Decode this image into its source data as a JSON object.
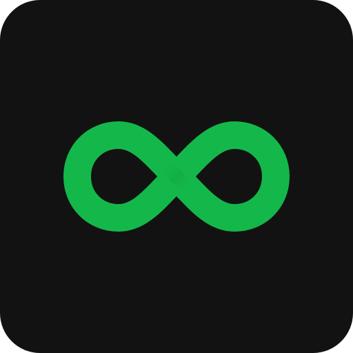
{
  "app_icon": {
    "glyph": "infinity-icon",
    "colors": {
      "background": "#121212",
      "loop": "#14B84A",
      "loop_shadow": "#0E9A3C",
      "canvas": "#FFFFFF"
    }
  }
}
